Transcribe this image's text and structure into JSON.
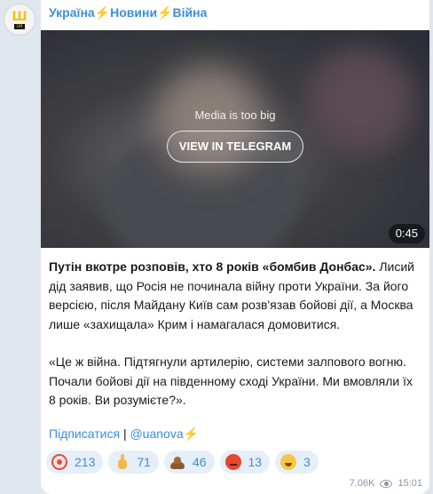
{
  "channel": {
    "avatar_icon": "trident-logo-icon",
    "title": "Україна⚡Новини⚡Війна"
  },
  "media": {
    "note": "Media is too big",
    "button_label": "VIEW IN TELEGRAM",
    "duration": "0:45"
  },
  "message": {
    "headline": "Путін вкотре розповів, хто 8 років «бомбив Донбас».",
    "body": " Лисий дід заявив, що Росія не починала війну проти України. За його версією, після Майдану Київ сам розв'язав бойові дії, а Москва лише «захищала» Крим і намагалася домовитися.",
    "quote": "«Це ж війна. Підтягнули артилерію, системи залпового вогню. Почали бойові дії на південному сході України. Ми вмовляли їх 8 років. Ви розумієте?»."
  },
  "links": {
    "subscribe": "Підписатися",
    "separator": "|",
    "handle": "@uanova⚡"
  },
  "reactions": [
    {
      "icon": "clown-face-icon",
      "count": "213"
    },
    {
      "icon": "middle-finger-icon",
      "count": "71"
    },
    {
      "icon": "poop-icon",
      "count": "46"
    },
    {
      "icon": "angry-face-icon",
      "count": "13"
    },
    {
      "icon": "grinning-face-icon",
      "count": "3"
    }
  ],
  "meta": {
    "views": "7.06K",
    "time": "15:01"
  },
  "colors": {
    "accent": "#3a8fd8",
    "background": "#dfe6ee",
    "reaction_bg": "#e6eef7"
  }
}
